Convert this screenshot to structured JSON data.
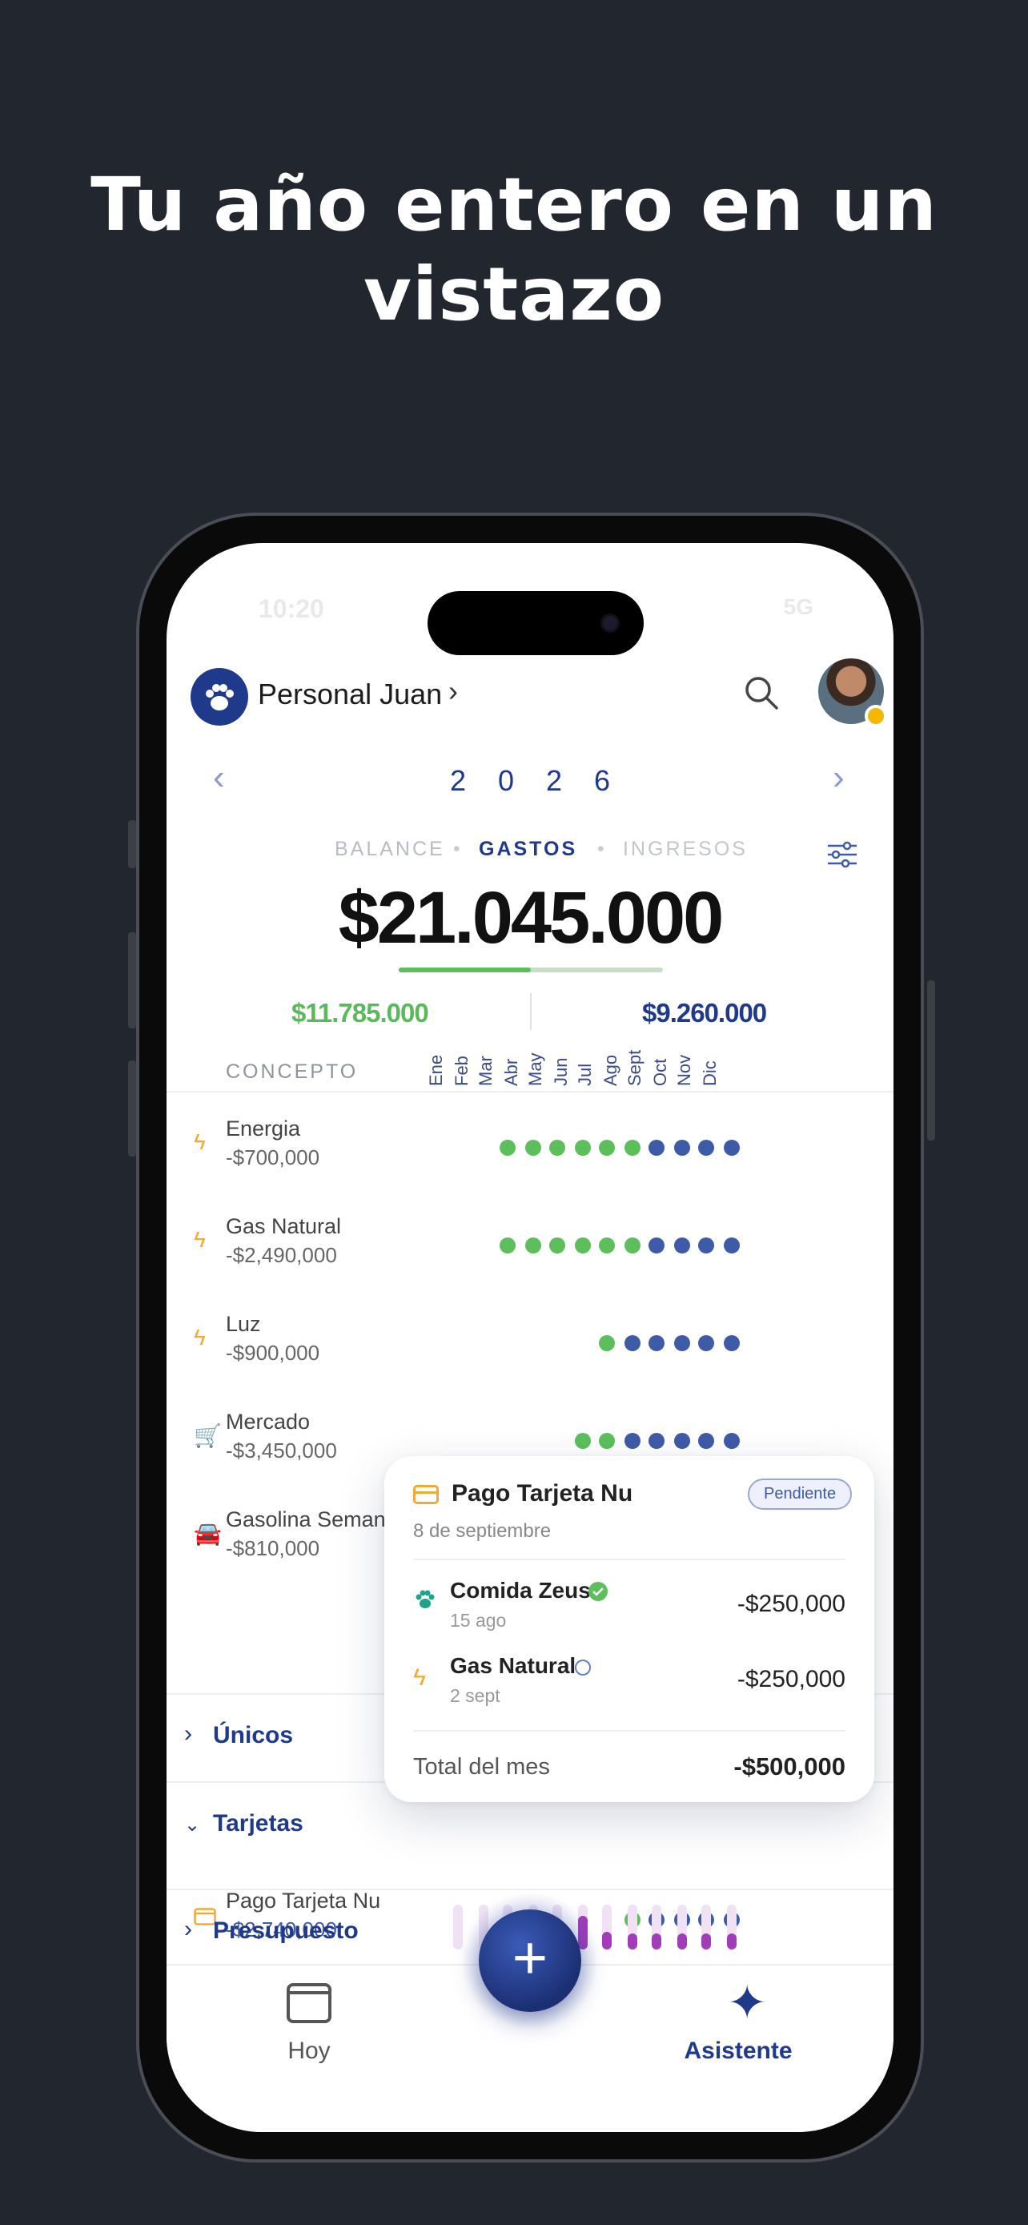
{
  "headline": [
    "Tu año entero en un",
    "vistazo"
  ],
  "status": {
    "time": "10:20",
    "right": "5G"
  },
  "header": {
    "account_name": "Personal Juan"
  },
  "year": "2026",
  "tabs": {
    "balance": "BALANCE",
    "gastos": "GASTOS",
    "ingresos": "INGRESOS",
    "selected": "GASTOS"
  },
  "summary": {
    "total": "$21.045.000",
    "left": "$11.785.000",
    "right": "$9.260.000",
    "progress": 0.5
  },
  "table": {
    "concept_header": "CONCEPTO",
    "months": [
      "Ene",
      "Feb",
      "Mar",
      "Abr",
      "May",
      "Jun",
      "Jul",
      "Ago",
      "Sept",
      "Oct",
      "Nov",
      "Dic"
    ],
    "rows": [
      {
        "name": "Energia",
        "amount": "-$700,000",
        "icon": "bolt-icon",
        "statuses": [
          "",
          "",
          "g",
          "g",
          "g",
          "g",
          "g",
          "g",
          "b",
          "b",
          "b",
          "b"
        ]
      },
      {
        "name": "Gas Natural",
        "amount": "-$2,490,000",
        "icon": "bolt-icon",
        "statuses": [
          "",
          "",
          "g",
          "g",
          "g",
          "g",
          "g",
          "g",
          "b",
          "b",
          "b",
          "b"
        ]
      },
      {
        "name": "Luz",
        "amount": "-$900,000",
        "icon": "bolt-icon",
        "statuses": [
          "",
          "",
          "",
          "",
          "",
          "",
          "g",
          "b",
          "b",
          "b",
          "b",
          "b"
        ]
      },
      {
        "name": "Mercado",
        "amount": "-$3,450,000",
        "icon": "cart-icon",
        "statuses": [
          "",
          "",
          "",
          "",
          "",
          "g",
          "g",
          "b",
          "b",
          "b",
          "b",
          "b"
        ]
      },
      {
        "name": "Gasolina Seman",
        "amount": "-$810,000",
        "icon": "car-icon",
        "statuses": []
      }
    ],
    "sections": {
      "unicos": "Únicos",
      "tarjetas": "Tarjetas",
      "presupuesto": "Presupuesto"
    },
    "card_row": {
      "name": "Pago Tarjeta Nu",
      "amount": "-$2,740,000",
      "icon": "card-icon",
      "statuses": [
        "",
        "",
        "",
        "",
        "",
        "",
        "",
        "g",
        "b",
        "b",
        "b",
        "b"
      ]
    },
    "budget_levels": [
      0,
      0,
      0,
      0,
      0.2,
      0.75,
      0.4,
      0.35,
      0.35,
      0.35,
      0.35,
      0.35
    ],
    "colors": {
      "paid": "#5cbf5c",
      "pending": "#3e5ba8",
      "budget": "#a23cb8"
    }
  },
  "popup": {
    "title": "Pago Tarjeta Nu",
    "date": "8 de septiembre",
    "badge": "Pendiente",
    "items": [
      {
        "name": "Comida Zeus",
        "sub": "15 ago",
        "amount": "-$250,000",
        "icon": "paw-icon",
        "status_icon": "check-circle-icon"
      },
      {
        "name": "Gas Natural",
        "sub": "2 sept",
        "amount": "-$250,000",
        "icon": "bolt-icon",
        "status_icon": "empty-circle-icon"
      }
    ],
    "total_label": "Total del mes",
    "total_value": "-$500,000"
  },
  "tabbar": {
    "hoy": "Hoy",
    "asistente": "Asistente",
    "fab": "+"
  }
}
